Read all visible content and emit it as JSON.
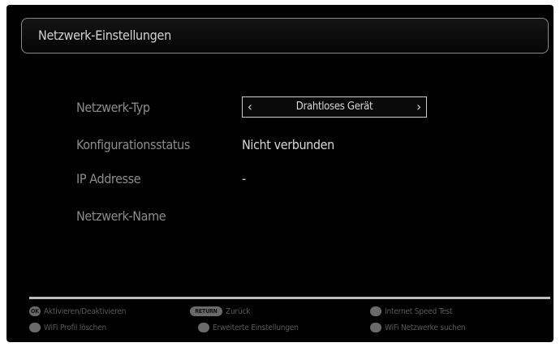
{
  "title": "Netzwerk-Einstellungen",
  "rows": [
    {
      "label": "Netzwerk-Typ",
      "value": "Drahtloses Gerät"
    },
    {
      "label": "Konfigurationsstatus",
      "value": "Nicht verbunden"
    },
    {
      "label": "IP Addresse",
      "value": "-"
    },
    {
      "label": "Netzwerk-Name",
      "value": ""
    }
  ],
  "selector_arrows": {
    "left": "‹",
    "right": "›"
  },
  "hints": [
    {
      "key": "OK",
      "label": "Aktivieren/Deaktivieren",
      "icon": "ok-key-icon"
    },
    {
      "key": "RETURN",
      "label": "Zurück",
      "icon": "return-key-icon"
    },
    {
      "key": "",
      "label": "Internet Speed Test",
      "icon": "color-key-icon"
    },
    {
      "key": "",
      "label": "WiFi Profil löschen",
      "icon": "color-key-icon"
    },
    {
      "key": "",
      "label": "Erweiterte Einstellungen",
      "icon": "color-key-icon"
    },
    {
      "key": "",
      "label": "WiFi Netzwerke suchen",
      "icon": "color-key-icon"
    }
  ]
}
